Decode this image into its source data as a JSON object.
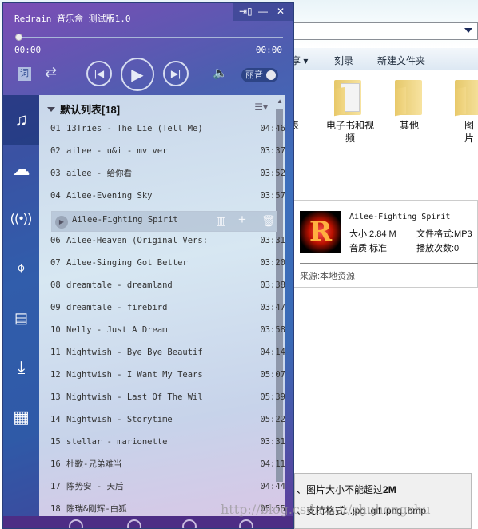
{
  "player": {
    "title": "Redrain 音乐盒 测试版1.0",
    "elapsed": "00:00",
    "total": "00:00",
    "lyric_label": "词",
    "beauty_label": "丽音",
    "progress": 0
  },
  "playlist": {
    "name": "默认列表[18]",
    "tracks": [
      {
        "num": "01",
        "title": "13Tries - The Lie (Tell Me)",
        "duration": "04:46"
      },
      {
        "num": "02",
        "title": "ailee - u&i - mv ver",
        "duration": "03:37"
      },
      {
        "num": "03",
        "title": "ailee - 给你看",
        "duration": "03:52"
      },
      {
        "num": "04",
        "title": "Ailee-Evening Sky",
        "duration": "03:57"
      },
      {
        "num": "05",
        "title": "Ailee-Fighting Spirit",
        "duration": ""
      },
      {
        "num": "06",
        "title": "Ailee-Heaven (Original Vers:",
        "duration": "03:31"
      },
      {
        "num": "07",
        "title": "Ailee-Singing Got Better",
        "duration": "03:20"
      },
      {
        "num": "08",
        "title": "dreamtale - dreamland",
        "duration": "03:38"
      },
      {
        "num": "09",
        "title": "dreamtale - firebird",
        "duration": "03:47"
      },
      {
        "num": "10",
        "title": "Nelly - Just A Dream",
        "duration": "03:58"
      },
      {
        "num": "11",
        "title": "Nightwish - Bye Bye Beautif",
        "duration": "04:14"
      },
      {
        "num": "12",
        "title": "Nightwish - I Want My Tears",
        "duration": "05:07"
      },
      {
        "num": "13",
        "title": "Nightwish - Last Of The Wil",
        "duration": "05:39"
      },
      {
        "num": "14",
        "title": "Nightwish - Storytime",
        "duration": "05:22"
      },
      {
        "num": "15",
        "title": "stellar - marionette",
        "duration": "03:31"
      },
      {
        "num": "16",
        "title": "杜歌-兄弟难当",
        "duration": "04:11"
      },
      {
        "num": "17",
        "title": "陈势安 - 天后",
        "duration": "04:44"
      },
      {
        "num": "18",
        "title": "陈瑞&刚辉-白狐",
        "duration": "05:55"
      }
    ]
  },
  "tooltip": {
    "title": "Ailee-Fighting Spirit",
    "size": "大小:2.84 M",
    "format": "文件格式:MP3",
    "quality": "音质:标准",
    "plays": "播放次数:0",
    "source": "来源:本地资源"
  },
  "explorer": {
    "toolbar": [
      "享 ▾",
      "刻录",
      "新建文件夹"
    ],
    "folders": [
      "表",
      "电子书和视频",
      "其他",
      "图片"
    ]
  },
  "note": {
    "line1": "、图片大小不能超过",
    "line1_bold": "2M",
    "line2": "、支持格式: .jpg .gif .png .bmp"
  },
  "watermark": "http://blog.csdn.net/zhuhongshu"
}
